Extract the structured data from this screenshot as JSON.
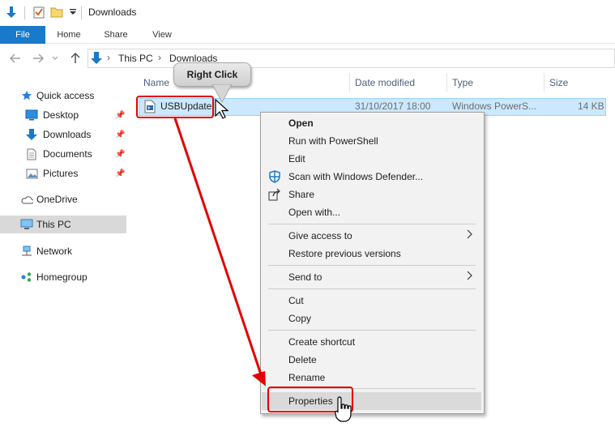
{
  "window": {
    "title": "Downloads"
  },
  "quick_access_toolbar": {
    "icons": [
      "down-arrow-icon",
      "properties-check-icon",
      "new-folder-icon",
      "dropdown-icon"
    ]
  },
  "ribbon": {
    "tabs": [
      {
        "label": "File",
        "active": true
      },
      {
        "label": "Home"
      },
      {
        "label": "Share"
      },
      {
        "label": "View"
      }
    ]
  },
  "address_bar": {
    "breadcrumbs": [
      "This PC",
      "Downloads"
    ],
    "separator": "›"
  },
  "nav_pane": {
    "items": [
      {
        "label": "Quick access",
        "icon": "star-icon",
        "pinned": false
      },
      {
        "label": "Desktop",
        "icon": "desktop-icon",
        "pinned": true
      },
      {
        "label": "Downloads",
        "icon": "downloads-icon",
        "pinned": true
      },
      {
        "label": "Documents",
        "icon": "documents-icon",
        "pinned": true
      },
      {
        "label": "Pictures",
        "icon": "pictures-icon",
        "pinned": true
      },
      {
        "label": "OneDrive",
        "icon": "onedrive-icon",
        "pinned": false
      },
      {
        "label": "This PC",
        "icon": "this-pc-icon",
        "pinned": false,
        "selected": true
      },
      {
        "label": "Network",
        "icon": "network-icon",
        "pinned": false
      },
      {
        "label": "Homegroup",
        "icon": "homegroup-icon",
        "pinned": false
      }
    ]
  },
  "file_list": {
    "columns": [
      "Name",
      "Date modified",
      "Type",
      "Size"
    ],
    "rows": [
      {
        "name": "USBUpdate",
        "date_modified": "31/10/2017 18:00",
        "type": "Windows PowerS...",
        "size": "14 KB",
        "selected": true
      }
    ]
  },
  "callout": {
    "text": "Right Click"
  },
  "context_menu": {
    "items": [
      {
        "label": "Open",
        "bold": true
      },
      {
        "label": "Run with PowerShell"
      },
      {
        "label": "Edit"
      },
      {
        "label": "Scan with Windows Defender...",
        "icon": "defender-icon"
      },
      {
        "label": "Share",
        "icon": "share-icon"
      },
      {
        "label": "Open with..."
      },
      {
        "label": "Give access to",
        "submenu": true
      },
      {
        "label": "Restore previous versions"
      },
      {
        "label": "Send to",
        "submenu": true
      },
      {
        "label": "Cut"
      },
      {
        "label": "Copy"
      },
      {
        "label": "Create shortcut"
      },
      {
        "label": "Delete"
      },
      {
        "label": "Rename"
      },
      {
        "label": "Properties",
        "highlighted": true
      }
    ]
  },
  "annotation": {
    "color": "#e30000"
  },
  "colors": {
    "accent": "#1979ca",
    "selection": "#cce8ff",
    "selection_border": "#99d1ff"
  }
}
